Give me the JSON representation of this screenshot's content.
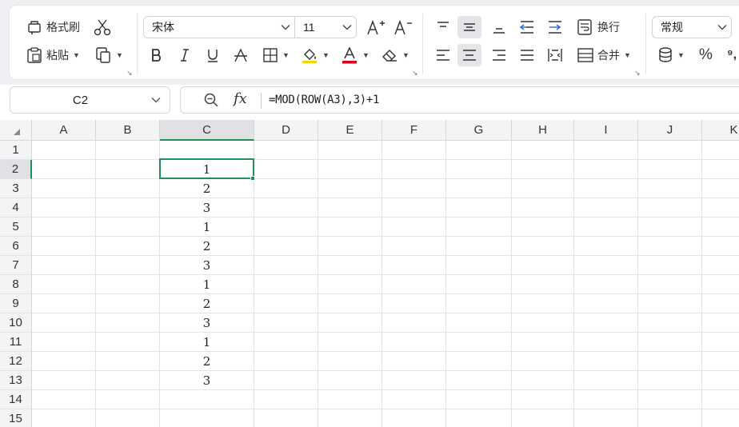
{
  "ribbon": {
    "format_painter_label": "格式刷",
    "paste_label": "粘贴",
    "font_name": "宋体",
    "font_size": "11",
    "wrap_label": "换行",
    "merge_label": "合并",
    "number_format": "常规",
    "percent_symbol": "%",
    "comma_symbol": "⁹,",
    "font_color": "#d9001b"
  },
  "name_box": {
    "value": "C2"
  },
  "formula_bar": {
    "fx_label": "fx",
    "formula": "=MOD(ROW(A3),3)+1"
  },
  "sheet": {
    "columns": [
      "A",
      "B",
      "C",
      "D",
      "E",
      "F",
      "G",
      "H",
      "I",
      "J",
      "K"
    ],
    "rows": [
      "1",
      "2",
      "3",
      "4",
      "5",
      "6",
      "7",
      "8",
      "9",
      "10",
      "11",
      "12",
      "13",
      "14",
      "15"
    ],
    "active_column": "C",
    "active_row": "2",
    "column_c_values": [
      "",
      "1",
      "2",
      "3",
      "1",
      "2",
      "3",
      "1",
      "2",
      "3",
      "1",
      "2",
      "3",
      "",
      ""
    ]
  },
  "colors": {
    "selection": "#1f8f5c",
    "header_bg": "#f3f4f6"
  }
}
